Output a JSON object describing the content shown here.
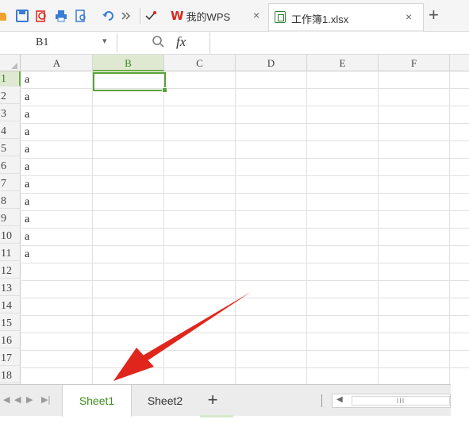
{
  "toolbar": {
    "icons": [
      "folder-icon",
      "save-icon",
      "export-pdf-icon",
      "print-icon",
      "print-preview-icon",
      "undo-icon",
      "more-icon",
      "customize-icon"
    ],
    "tabs": [
      {
        "label": "我的WPS",
        "close": "×"
      },
      {
        "label": "工作簿1.xlsx",
        "close": "×"
      }
    ],
    "new_tab": "+"
  },
  "formula_bar": {
    "name_box": "B1",
    "dropdown": "▾",
    "fx": "fx",
    "value": ""
  },
  "grid": {
    "columns": [
      "A",
      "B",
      "C",
      "D",
      "E",
      "F"
    ],
    "selected_column": "B",
    "rows": [
      "1",
      "2",
      "3",
      "4",
      "5",
      "6",
      "7",
      "8",
      "9",
      "10",
      "11",
      "12",
      "13",
      "14",
      "15",
      "16",
      "17",
      "18"
    ],
    "selected_row": "1",
    "col_a_values": [
      "a",
      "a",
      "a",
      "a",
      "a",
      "a",
      "a",
      "a",
      "a",
      "a",
      "a"
    ],
    "active_cell": "B1"
  },
  "sheet_bar": {
    "nav": [
      "◀",
      "◀",
      "▶",
      "▶|"
    ],
    "tabs": [
      {
        "label": "Sheet1",
        "active": true
      },
      {
        "label": "Sheet2",
        "active": false
      }
    ],
    "add_sheet": "+",
    "scroll_thumb": "III"
  },
  "colors": {
    "accent_green": "#58a23c",
    "wps_red": "#d9261c",
    "arrow_red": "#e0261c"
  }
}
